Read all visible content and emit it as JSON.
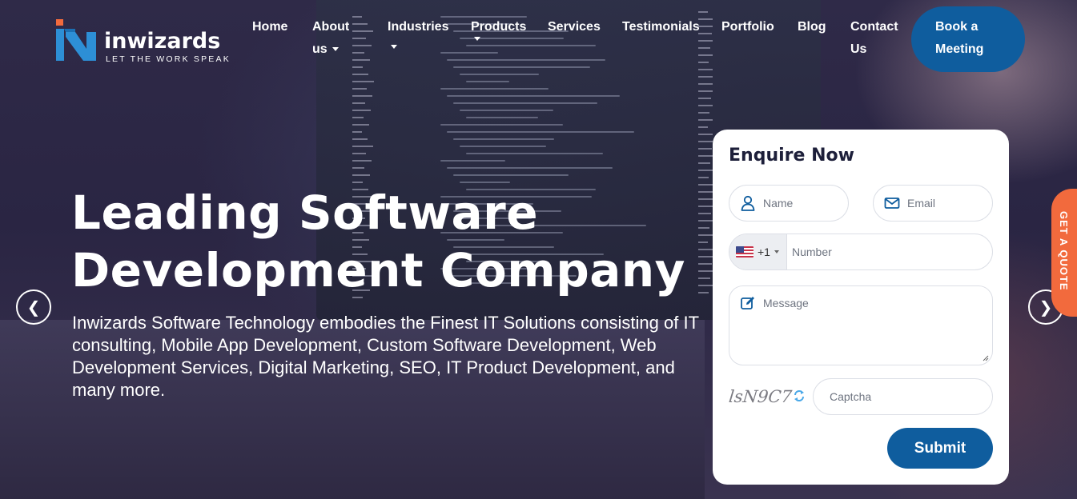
{
  "brand": {
    "name": "inwizards",
    "tagline": "LET THE WORK SPEAK"
  },
  "nav": {
    "home": "Home",
    "about_1": "About",
    "about_2": "us",
    "industries": "Industries",
    "products": "Products",
    "services": "Services",
    "testimonials": "Testimonials",
    "portfolio": "Portfolio",
    "blog": "Blog",
    "contact_1": "Contact",
    "contact_2": "Us",
    "book_1": "Book a",
    "book_2": "Meeting"
  },
  "hero": {
    "title_line1": "Leading Software",
    "title_line2": "Development Company",
    "description": "Inwizards Software Technology embodies the Finest IT Solutions consisting of IT consulting, Mobile App Development, Custom Software Development, Web Development Services, Digital Marketing, SEO, IT Product Development, and many more.",
    "prev_icon": "chevron-left-icon",
    "next_icon": "chevron-right-icon",
    "prev_glyph": "❮",
    "next_glyph": "❯"
  },
  "quote_tab": "GET A QUOTE",
  "form": {
    "title": "Enquire Now",
    "name_placeholder": "Name",
    "email_placeholder": "Email",
    "dial_code": "+1",
    "number_placeholder": "Number",
    "message_placeholder": "Message",
    "captcha_text": "lsN9C7",
    "captcha_placeholder": "Captcha",
    "submit_label": "Submit"
  },
  "colors": {
    "primary_blue": "#0f5d9e",
    "quote_orange": "#f26a3d",
    "heading_dark": "#1d1f3a",
    "logo_blue": "#2d8fd6",
    "logo_orange": "#f26a3d"
  }
}
